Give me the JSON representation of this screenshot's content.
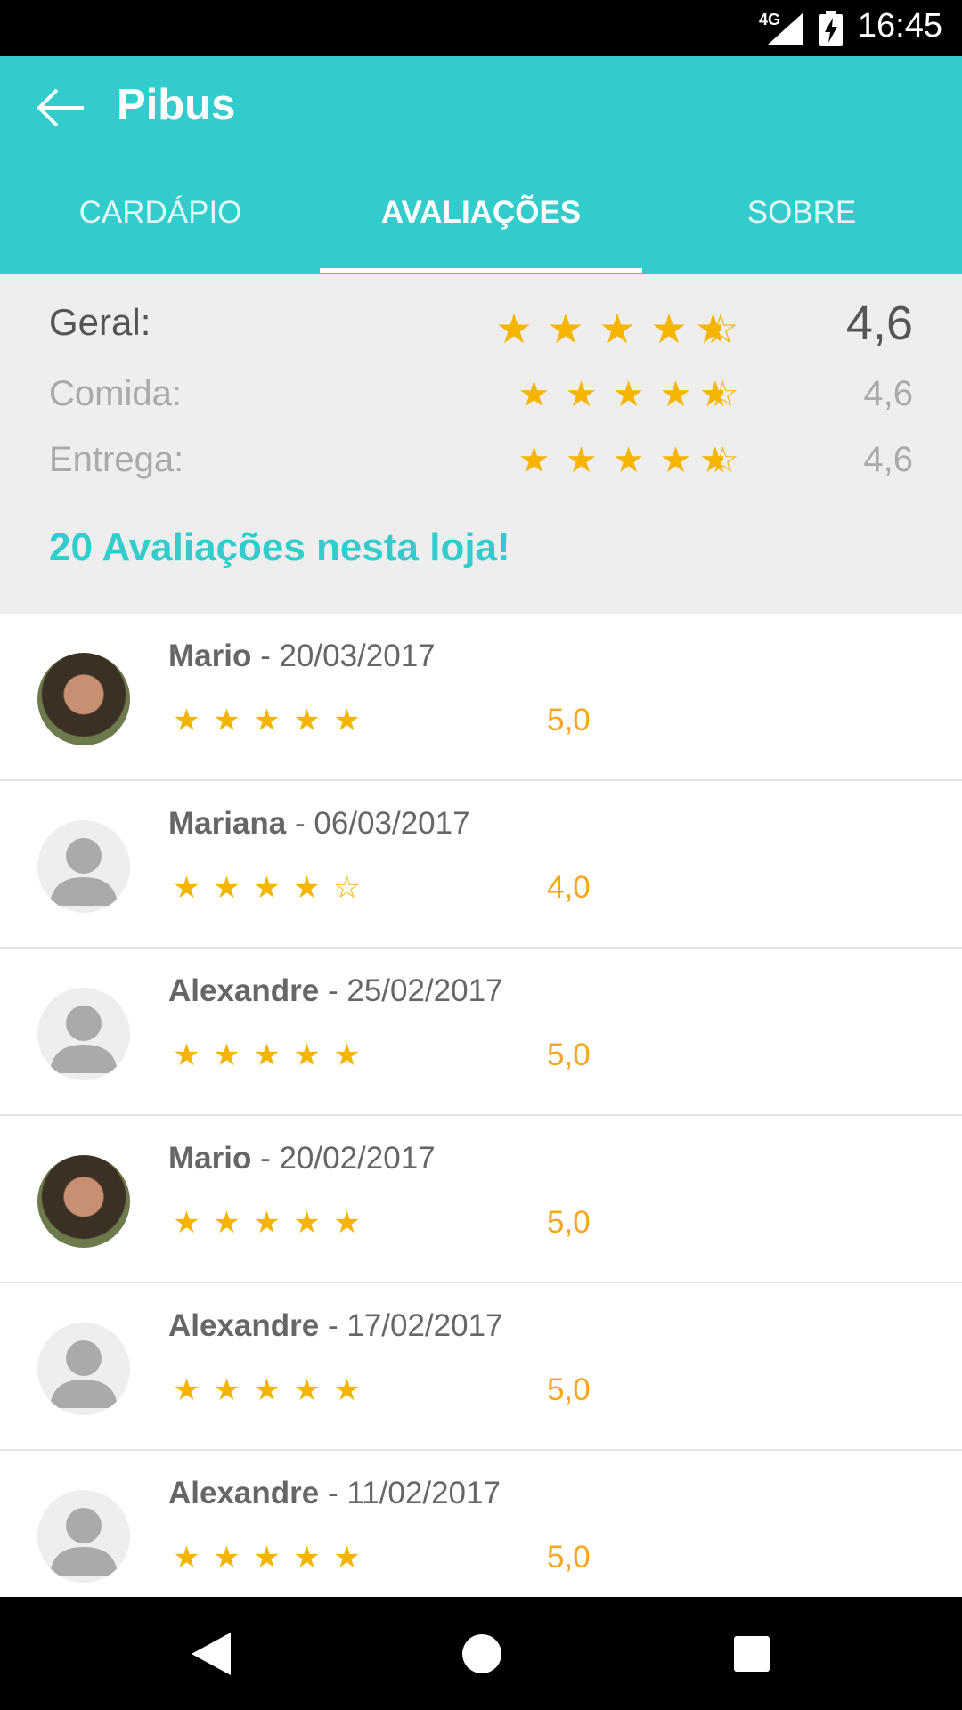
{
  "status_bar": {
    "time": "16:45",
    "network": "4G"
  },
  "app_bar": {
    "title": "Pibus"
  },
  "tabs": [
    {
      "label": "CARDÁPIO",
      "active": false
    },
    {
      "label": "AVALIAÇÕES",
      "active": true
    },
    {
      "label": "SOBRE",
      "active": false
    }
  ],
  "summary": {
    "rows": [
      {
        "label": "Geral:",
        "value": "4,6",
        "rating": 4.6
      },
      {
        "label": "Comida:",
        "value": "4,6",
        "rating": 4.6
      },
      {
        "label": "Entrega:",
        "value": "4,6",
        "rating": 4.6
      }
    ],
    "count_text": "20 Avaliações nesta loja!"
  },
  "reviews": [
    {
      "name": "Mario",
      "date": " - 20/03/2017",
      "rating": 5,
      "value": "5,0",
      "avatar": "photo"
    },
    {
      "name": "Mariana",
      "date": " - 06/03/2017",
      "rating": 4,
      "value": "4,0",
      "avatar": "placeholder"
    },
    {
      "name": "Alexandre",
      "date": " - 25/02/2017",
      "rating": 5,
      "value": "5,0",
      "avatar": "placeholder"
    },
    {
      "name": "Mario",
      "date": " - 20/02/2017",
      "rating": 5,
      "value": "5,0",
      "avatar": "photo"
    },
    {
      "name": "Alexandre",
      "date": " - 17/02/2017",
      "rating": 5,
      "value": "5,0",
      "avatar": "placeholder"
    },
    {
      "name": "Alexandre",
      "date": " - 11/02/2017",
      "rating": 5,
      "value": "5,0",
      "avatar": "placeholder"
    }
  ],
  "colors": {
    "accent": "#33cccc",
    "star": "#f5b400",
    "rating_value": "#f5a623"
  },
  "icons": {
    "back": "arrow-left-icon",
    "star_full": "star-icon",
    "star_half": "star-half-icon",
    "star_empty": "star-outline-icon",
    "avatar_placeholder": "person-icon"
  }
}
